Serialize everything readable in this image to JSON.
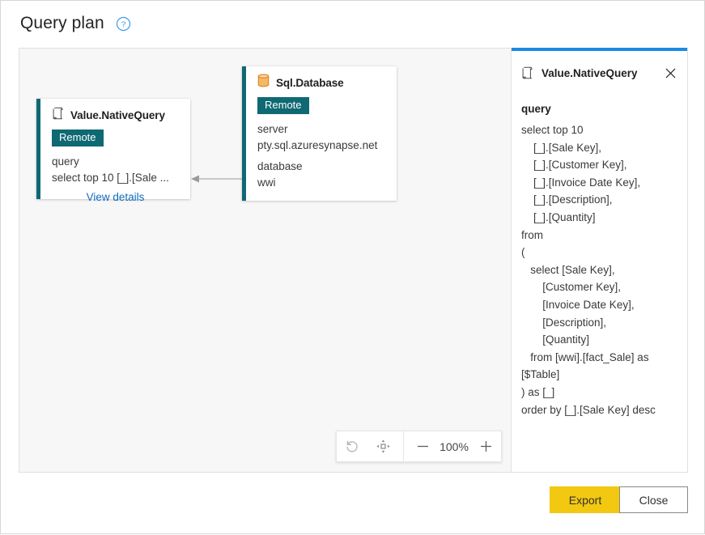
{
  "header": {
    "title": "Query plan",
    "help_icon": "help-circle-icon"
  },
  "canvas": {
    "nodes": [
      {
        "id": "value-nativequery",
        "icon": "script-scroll-icon",
        "title": "Value.NativeQuery",
        "badge": "Remote",
        "prop_label": "query",
        "prop_value": "select top 10 [_].[Sale ...",
        "link": "View details"
      },
      {
        "id": "sql-database",
        "icon": "database-cylinder-icon",
        "title": "Sql.Database",
        "badge": "Remote",
        "prop1_label": "server",
        "prop1_value": "pty.sql.azuresynapse.net",
        "prop2_label": "database",
        "prop2_value": "wwi"
      }
    ],
    "edge": {
      "name": "node-connector-arrow"
    }
  },
  "zoom_toolbar": {
    "reset_icon": "undo-arrow-icon",
    "fit_icon": "fit-to-view-icon",
    "zoom_out_icon": "minus-icon",
    "level": "100%",
    "zoom_in_icon": "plus-icon"
  },
  "side_panel": {
    "icon": "script-scroll-icon",
    "title": "Value.NativeQuery",
    "close_icon": "close-x-icon",
    "property_label": "query",
    "query_text": "select top 10\n    [_].[Sale Key],\n    [_].[Customer Key],\n    [_].[Invoice Date Key],\n    [_].[Description],\n    [_].[Quantity]\nfrom\n(\n   select [Sale Key],\n       [Customer Key],\n       [Invoice Date Key],\n       [Description],\n       [Quantity]\n   from [wwi].[fact_Sale] as [$Table]\n) as [_]\norder by [_].[Sale Key] desc"
  },
  "footer": {
    "export_label": "Export",
    "close_label": "Close"
  },
  "colors": {
    "accent_teal": "#0f6973",
    "panel_blue": "#1a8ae5",
    "link_blue": "#0f6cbd",
    "export_yellow": "#f2c811",
    "db_icon_orange": "#f0a03c",
    "canvas_bg": "#f7f7f7"
  }
}
